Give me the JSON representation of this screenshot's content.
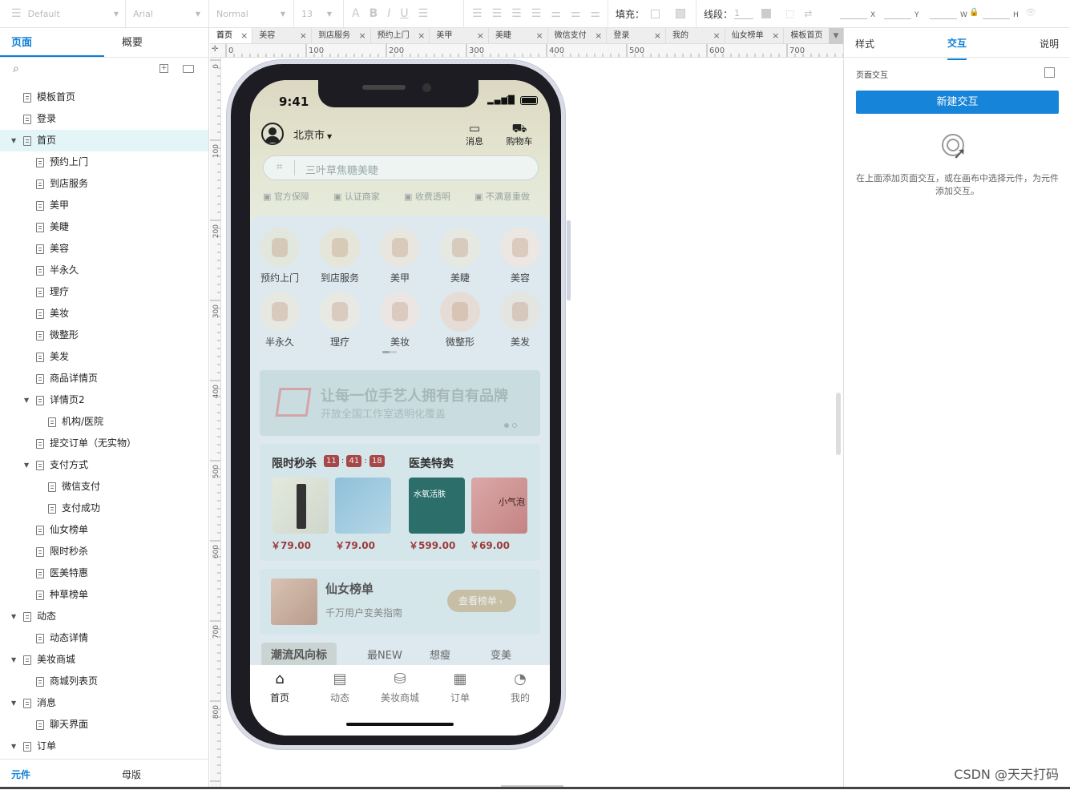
{
  "toolbar": {
    "style_select": "Default",
    "font_select": "Arial",
    "weight_select": "Normal",
    "size_select": "13",
    "fill_label": "填充：",
    "stroke_label": "线段：",
    "stroke_value": "1",
    "x_label": "X",
    "y_label": "Y",
    "w_label": "W",
    "h_label": "H"
  },
  "left_panel": {
    "tabs": [
      "页面",
      "概要"
    ],
    "tree": [
      {
        "label": "模板首页",
        "level": 1,
        "arrow": "",
        "selected": false
      },
      {
        "label": "登录",
        "level": 1,
        "arrow": "",
        "selected": false
      },
      {
        "label": "首页",
        "level": 1,
        "arrow": "▼",
        "selected": true
      },
      {
        "label": "预约上门",
        "level": 2,
        "arrow": "",
        "selected": false
      },
      {
        "label": "到店服务",
        "level": 2,
        "arrow": "",
        "selected": false
      },
      {
        "label": "美甲",
        "level": 2,
        "arrow": "",
        "selected": false
      },
      {
        "label": "美睫",
        "level": 2,
        "arrow": "",
        "selected": false
      },
      {
        "label": "美容",
        "level": 2,
        "arrow": "",
        "selected": false
      },
      {
        "label": "半永久",
        "level": 2,
        "arrow": "",
        "selected": false
      },
      {
        "label": "理疗",
        "level": 2,
        "arrow": "",
        "selected": false
      },
      {
        "label": "美妆",
        "level": 2,
        "arrow": "",
        "selected": false
      },
      {
        "label": "微整形",
        "level": 2,
        "arrow": "",
        "selected": false
      },
      {
        "label": "美发",
        "level": 2,
        "arrow": "",
        "selected": false
      },
      {
        "label": "商品详情页",
        "level": 2,
        "arrow": "",
        "selected": false
      },
      {
        "label": "详情页2",
        "level": 2,
        "arrow": "▼",
        "selected": false
      },
      {
        "label": "机构/医院",
        "level": 3,
        "arrow": "",
        "selected": false
      },
      {
        "label": "提交订单（无实物）",
        "level": 2,
        "arrow": "",
        "selected": false
      },
      {
        "label": "支付方式",
        "level": 2,
        "arrow": "▼",
        "selected": false
      },
      {
        "label": "微信支付",
        "level": 3,
        "arrow": "",
        "selected": false
      },
      {
        "label": "支付成功",
        "level": 3,
        "arrow": "",
        "selected": false
      },
      {
        "label": "仙女榜单",
        "level": 2,
        "arrow": "",
        "selected": false
      },
      {
        "label": "限时秒杀",
        "level": 2,
        "arrow": "",
        "selected": false
      },
      {
        "label": "医美特惠",
        "level": 2,
        "arrow": "",
        "selected": false
      },
      {
        "label": "种草榜单",
        "level": 2,
        "arrow": "",
        "selected": false
      },
      {
        "label": "动态",
        "level": 1,
        "arrow": "▼",
        "selected": false
      },
      {
        "label": "动态详情",
        "level": 2,
        "arrow": "",
        "selected": false
      },
      {
        "label": "美妆商城",
        "level": 1,
        "arrow": "▼",
        "selected": false
      },
      {
        "label": "商城列表页",
        "level": 2,
        "arrow": "",
        "selected": false
      },
      {
        "label": "消息",
        "level": 1,
        "arrow": "▼",
        "selected": false
      },
      {
        "label": "聊天界面",
        "level": 2,
        "arrow": "",
        "selected": false
      },
      {
        "label": "订单",
        "level": 1,
        "arrow": "▼",
        "selected": false
      }
    ],
    "footer_tabs": [
      "元件",
      "母版"
    ]
  },
  "doc_tabs": [
    "首页",
    "美容",
    "到店服务",
    "预约上门",
    "美甲",
    "美睫",
    "微信支付",
    "登录",
    "我的",
    "仙女榜单",
    "模板首页"
  ],
  "ruler": {
    "h_ticks": [
      "0",
      "100",
      "200",
      "300",
      "400",
      "500",
      "600",
      "700"
    ],
    "v_ticks": [
      "0",
      "100",
      "200",
      "300",
      "400",
      "500",
      "600",
      "700",
      "800"
    ]
  },
  "right_panel": {
    "tabs": [
      "样式",
      "交互",
      "说明"
    ],
    "section_title": "页面交互",
    "new_button": "新建交互",
    "hint": "在上面添加页面交互，或在画布中选择元件，为元件添加交互。"
  },
  "phone": {
    "time": "9:41",
    "city": "北京市",
    "msg_label": "消息",
    "cart_label": "购物车",
    "search_placeholder": "三叶草焦糖美睫",
    "guarantees": [
      "官方保障",
      "认证商家",
      "收费透明",
      "不满意重做"
    ],
    "categories": [
      "预约上门",
      "到店服务",
      "美甲",
      "美睫",
      "美容",
      "半永久",
      "理疗",
      "美妆",
      "微整形",
      "美发"
    ],
    "banner_title": "让每一位手艺人拥有自有品牌",
    "banner_sub": "开放全国工作室透明化覆盖",
    "flash_title": "限时秒杀",
    "countdown": [
      "11",
      "41",
      "18"
    ],
    "medical_title": "医美特卖",
    "prices": [
      "￥79.00",
      "￥79.00",
      "￥599.00",
      "￥69.00"
    ],
    "product_texts": [
      "水氧活肤",
      "小气泡"
    ],
    "rank_title": "仙女榜单",
    "rank_sub": "千万用户变美指南",
    "rank_btn": "查看榜单",
    "trend_tabs": [
      "潮流风向标",
      "最NEW",
      "想瘦",
      "变美"
    ],
    "tabbar": [
      "首页",
      "动态",
      "美妆商城",
      "订单",
      "我的"
    ]
  },
  "watermark": "CSDN @天天打码"
}
